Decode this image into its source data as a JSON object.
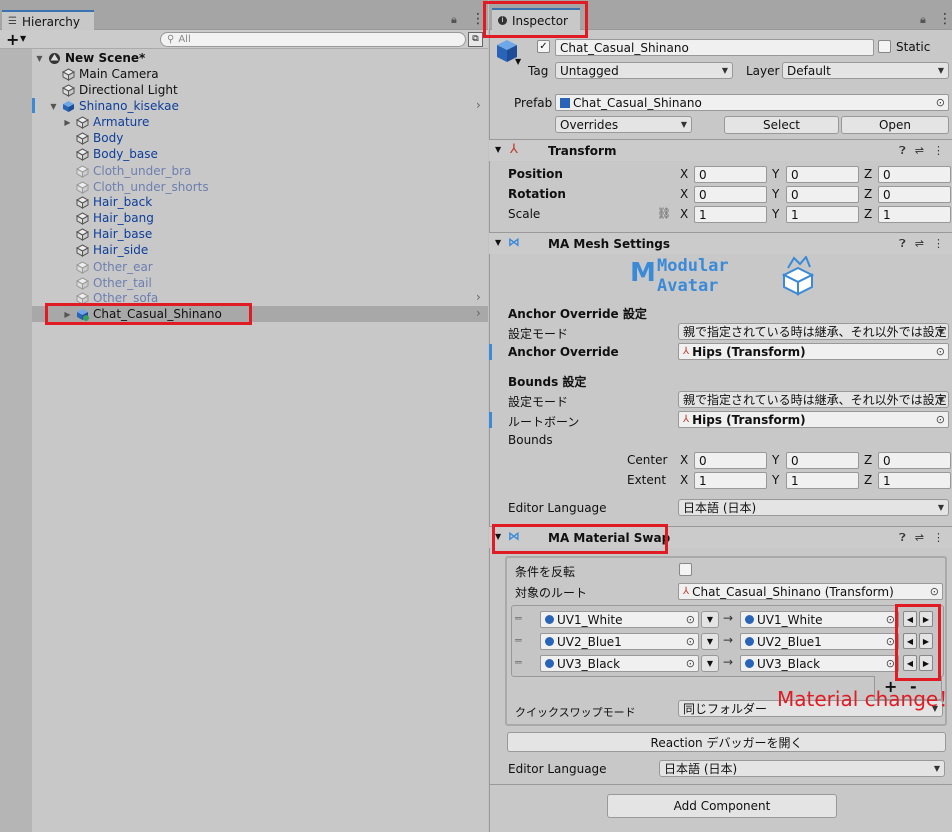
{
  "hierarchy": {
    "tab_label": "Hierarchy",
    "add_label": "+",
    "search_placeholder": "All",
    "items": [
      {
        "label": "New Scene*",
        "style": "bold",
        "icon": "unity-scene-icon"
      },
      {
        "label": "Main Camera",
        "style": "normal",
        "icon": "gameobject-icon"
      },
      {
        "label": "Directional Light",
        "style": "normal",
        "icon": "gameobject-icon"
      },
      {
        "label": "Shinano_kisekae",
        "style": "blue",
        "icon": "prefab-icon"
      },
      {
        "label": "Armature",
        "style": "blue",
        "icon": "prefab-icon"
      },
      {
        "label": "Body",
        "style": "blue",
        "icon": "prefab-icon"
      },
      {
        "label": "Body_base",
        "style": "blue",
        "icon": "prefab-icon"
      },
      {
        "label": "Cloth_under_bra",
        "style": "dim",
        "icon": "prefab-icon"
      },
      {
        "label": "Cloth_under_shorts",
        "style": "dim",
        "icon": "prefab-icon"
      },
      {
        "label": "Hair_back",
        "style": "blue",
        "icon": "prefab-icon"
      },
      {
        "label": "Hair_bang",
        "style": "blue",
        "icon": "prefab-icon"
      },
      {
        "label": "Hair_base",
        "style": "blue",
        "icon": "prefab-icon"
      },
      {
        "label": "Hair_side",
        "style": "blue",
        "icon": "prefab-icon"
      },
      {
        "label": "Other_ear",
        "style": "dim",
        "icon": "prefab-icon"
      },
      {
        "label": "Other_tail",
        "style": "dim",
        "icon": "prefab-icon"
      },
      {
        "label": "Other_sofa",
        "style": "dim",
        "icon": "prefab-icon"
      },
      {
        "label": "Chat_Casual_Shinano",
        "style": "normal",
        "icon": "prefab-variant-icon"
      }
    ]
  },
  "inspector": {
    "tab_label": "Inspector",
    "object_name": "Chat_Casual_Shinano",
    "static_label": "Static",
    "tag_label": "Tag",
    "tag_value": "Untagged",
    "layer_label": "Layer",
    "layer_value": "Default",
    "prefab_label": "Prefab",
    "prefab_value": "Chat_Casual_Shinano",
    "overrides_label": "Overrides",
    "select_label": "Select",
    "open_label": "Open",
    "transform": {
      "title": "Transform",
      "position_label": "Position",
      "rotation_label": "Rotation",
      "scale_label": "Scale",
      "position": [
        "0",
        "0",
        "0"
      ],
      "rotation": [
        "0",
        "0",
        "0"
      ],
      "scale": [
        "1",
        "1",
        "1"
      ]
    },
    "axes": [
      "X",
      "Y",
      "Z"
    ],
    "mesh_settings": {
      "title": "MA Mesh Settings",
      "logo_line1": "Modular",
      "logo_line2": "Avatar",
      "anchor_section": "Anchor Override 設定",
      "anchor_mode_label": "設定モード",
      "anchor_mode_value": "親で指定されている時は継承、それ以外では設定",
      "anchor_override_label": "Anchor Override",
      "anchor_override_value": "Hips (Transform)",
      "bounds_section": "Bounds 設定",
      "bounds_mode_label": "設定モード",
      "bounds_mode_value": "親で指定されている時は継承、それ以外では設定",
      "root_bone_label": "ルートボーン",
      "root_bone_value": "Hips (Transform)",
      "bounds_label": "Bounds",
      "center_label": "Center",
      "extent_label": "Extent",
      "center": [
        "0",
        "0",
        "0"
      ],
      "extent": [
        "1",
        "1",
        "1"
      ],
      "editor_language_label": "Editor Language",
      "editor_language_value": "日本語 (日本)"
    },
    "material_swap": {
      "title": "MA Material Swap",
      "invert_label": "条件を反転",
      "target_root_label": "対象のルート",
      "target_root_value": "Chat_Casual_Shinano (Transform)",
      "swaps": [
        {
          "from": "UV1_White",
          "to": "UV1_White"
        },
        {
          "from": "UV2_Blue1",
          "to": "UV2_Blue1"
        },
        {
          "from": "UV3_Black",
          "to": "UV3_Black"
        }
      ],
      "arrow": "→",
      "plus_label": "+",
      "minus_label": "-",
      "quick_swap_label": "クイックスワップモード",
      "quick_swap_value": "同じフォルダー",
      "reaction_debugger_label": "Reaction デバッガーを開く",
      "editor_language_label": "Editor Language",
      "editor_language_value": "日本語 (日本)"
    },
    "add_component_label": "Add Component"
  },
  "annotation": {
    "text": "Material change！",
    "color": "#e01b24"
  },
  "colors": {
    "highlight_red": "#e01b24",
    "prefab_blue": "#0d3e9a",
    "accent_blue": "#3a8ad8"
  }
}
